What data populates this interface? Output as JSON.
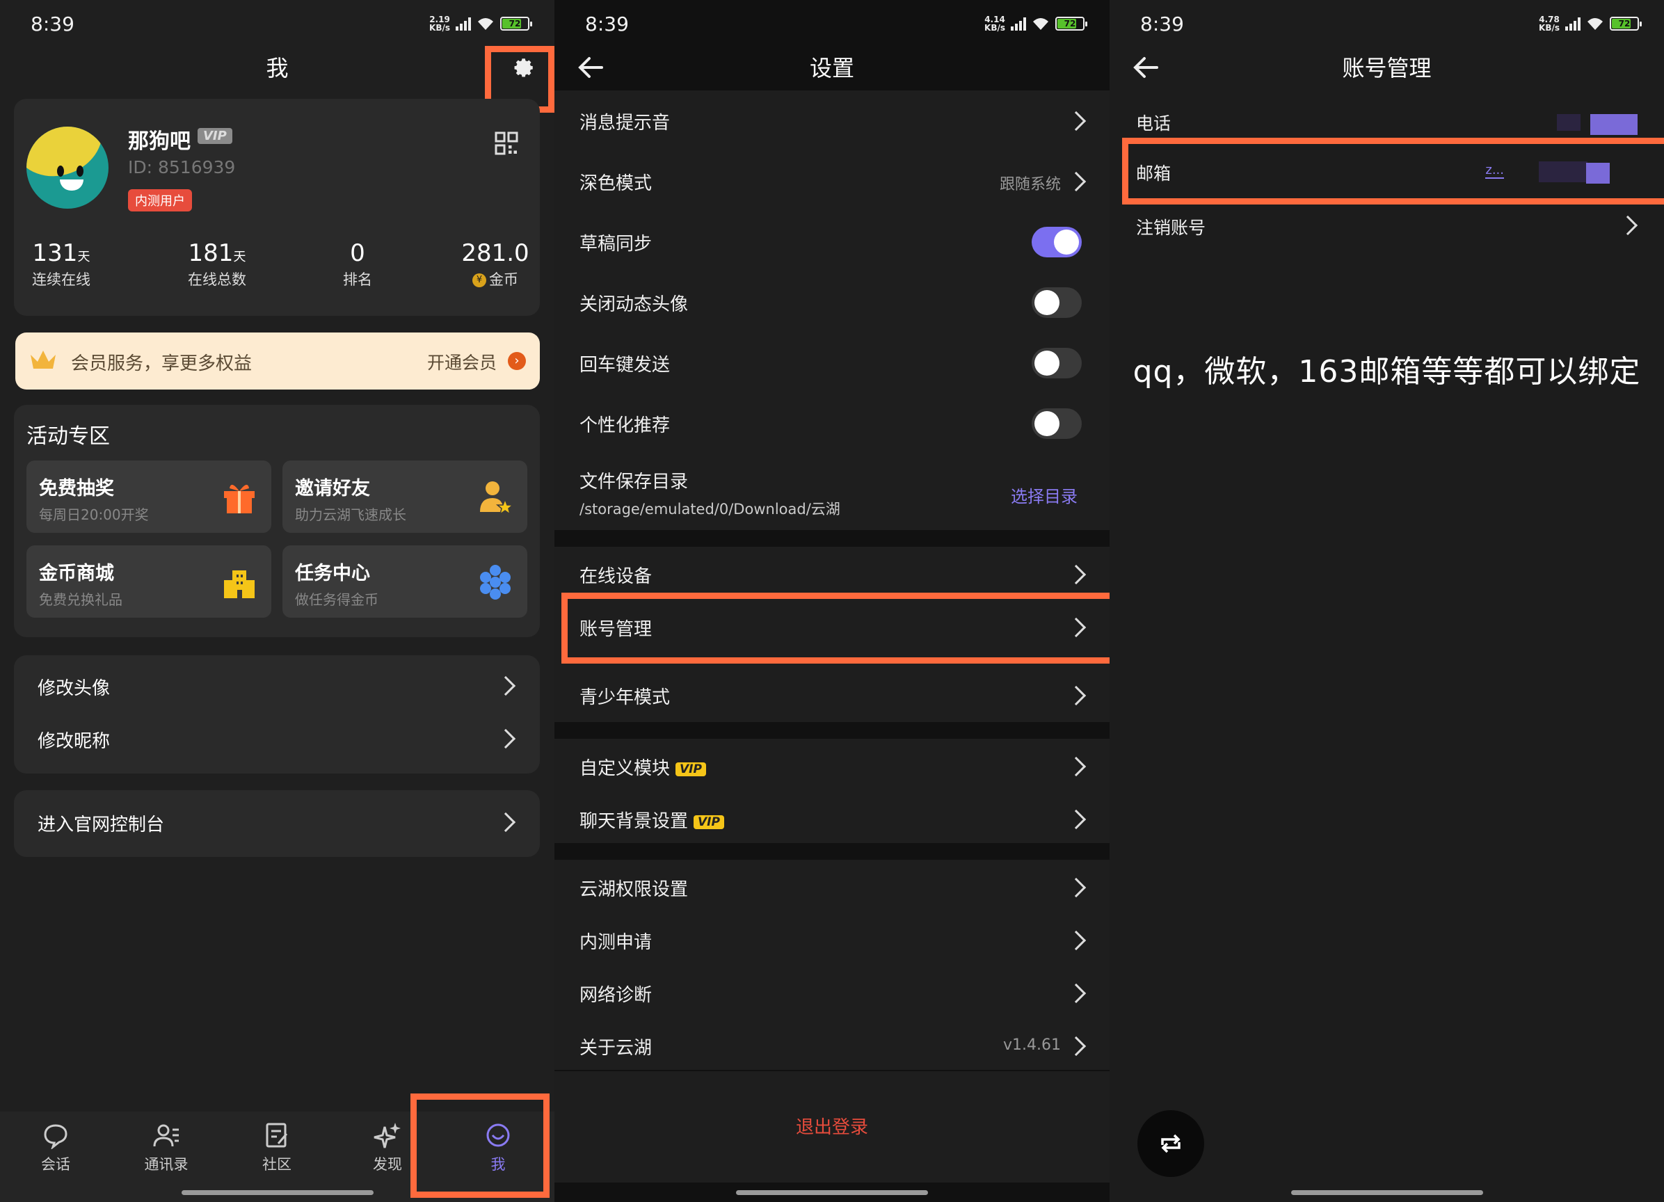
{
  "panel_me": {
    "status": {
      "time": "8:39",
      "net_speed": "2.19",
      "net_unit": "KB/s",
      "battery": "72"
    },
    "title": "我",
    "profile": {
      "name": "那狗吧",
      "vip": "VIP",
      "id": "ID: 8516939",
      "tag": "内测用户"
    },
    "stats": [
      {
        "value": "131",
        "unit": "天",
        "label": "连续在线"
      },
      {
        "value": "181",
        "unit": "天",
        "label": "在线总数"
      },
      {
        "value": "0",
        "unit": "",
        "label": "排名"
      },
      {
        "value": "281.0",
        "unit": "",
        "label": "金币",
        "coin": "¥"
      }
    ],
    "vip_banner": {
      "text": "会员服务，享更多权益",
      "action": "开通会员"
    },
    "activity": {
      "title": "活动专区",
      "tiles": [
        {
          "title": "免费抽奖",
          "subtitle": "每周日20:00开奖",
          "icon": "gift-icon"
        },
        {
          "title": "邀请好友",
          "subtitle": "助力云湖飞速成长",
          "icon": "user-star-icon"
        },
        {
          "title": "金币商城",
          "subtitle": "免费兑换礼品",
          "icon": "store-icon"
        },
        {
          "title": "任务中心",
          "subtitle": "做任务得金币",
          "icon": "hexagons-icon"
        }
      ]
    },
    "menu1": [
      "修改头像",
      "修改昵称"
    ],
    "menu2": [
      "进入官网控制台"
    ],
    "tabs": [
      {
        "label": "会话",
        "icon": "chat-icon"
      },
      {
        "label": "通讯录",
        "icon": "contacts-icon"
      },
      {
        "label": "社区",
        "icon": "edit-icon"
      },
      {
        "label": "发现",
        "icon": "sparkle-icon"
      },
      {
        "label": "我",
        "icon": "smile-icon"
      }
    ],
    "colors": {
      "highlight": "#ff6a3d",
      "accent": "#7b6ff0"
    }
  },
  "panel_settings": {
    "status": {
      "time": "8:39",
      "net_speed": "4.14",
      "net_unit": "KB/s",
      "battery": "72"
    },
    "title": "设置",
    "group1": [
      {
        "label": "消息提示音"
      },
      {
        "label": "深色模式",
        "value": "跟随系统"
      },
      {
        "label": "草稿同步",
        "toggle": "on"
      },
      {
        "label": "关闭动态头像",
        "toggle": "off"
      },
      {
        "label": "回车键发送",
        "toggle": "off"
      },
      {
        "label": "个性化推荐",
        "toggle": "off"
      }
    ],
    "file_dir": {
      "label": "文件保存目录",
      "path": "/storage/emulated/0/Download/云湖",
      "action": "选择目录"
    },
    "group2": [
      "在线设备",
      "账号管理",
      "青少年模式"
    ],
    "group3": [
      {
        "label": "自定义模块",
        "vip": "VIP"
      },
      {
        "label": "聊天背景设置",
        "vip": "VIP"
      }
    ],
    "group4": [
      {
        "label": "云湖权限设置"
      },
      {
        "label": "内测申请"
      },
      {
        "label": "网络诊断"
      },
      {
        "label": "关于云湖",
        "value": "v1.4.61"
      }
    ],
    "logout": "退出登录"
  },
  "panel_account": {
    "status": {
      "time": "8:39",
      "net_speed": "4.78",
      "net_unit": "KB/s",
      "battery": "72"
    },
    "title": "账号管理",
    "rows": [
      "电话",
      "邮箱",
      "注销账号"
    ],
    "email_value": "z...",
    "note": "qq，微软，163邮箱等等都可以绑定"
  }
}
